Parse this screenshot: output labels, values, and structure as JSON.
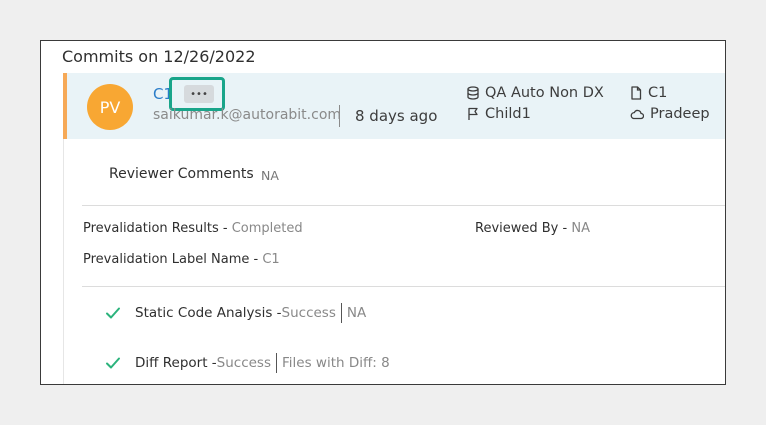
{
  "header": {
    "title": "Commits on 12/26/2022"
  },
  "commit": {
    "avatar_initials": "PV",
    "title": "C1",
    "more_label": "•••",
    "author_email": "saikumar.k@autorabit.com",
    "time_ago": "8 days ago",
    "environment": "QA Auto Non DX",
    "branch": "Child1",
    "file": "C1",
    "cloud_user": "Pradeep"
  },
  "review": {
    "comments_label": "Reviewer Comments",
    "comments_value": "NA"
  },
  "details": {
    "prevalidation_results_label": "Prevalidation Results - ",
    "prevalidation_results_value": "Completed",
    "reviewed_by_label": "Reviewed By - ",
    "reviewed_by_value": "NA",
    "prevalidation_label_name_label": "Prevalidation Label Name - ",
    "prevalidation_label_name_value": "C1"
  },
  "checks": [
    {
      "name": "Static Code Analysis - ",
      "status": "Success",
      "extra": "NA"
    },
    {
      "name": "Diff Report - ",
      "status": "Success",
      "extra": "Files with Diff: 8"
    }
  ],
  "colors": {
    "accent_link": "#2a7dc9",
    "avatar_bg": "#f8a733",
    "row_bg": "#e9f3f7",
    "row_left_border": "#f6a957",
    "highlight_box": "#19a58a",
    "check_green": "#2bb37c"
  },
  "icons": {
    "environment": "database-icon",
    "branch": "flag-icon",
    "file": "file-icon",
    "cloud": "cloud-icon",
    "check": "check-icon"
  }
}
